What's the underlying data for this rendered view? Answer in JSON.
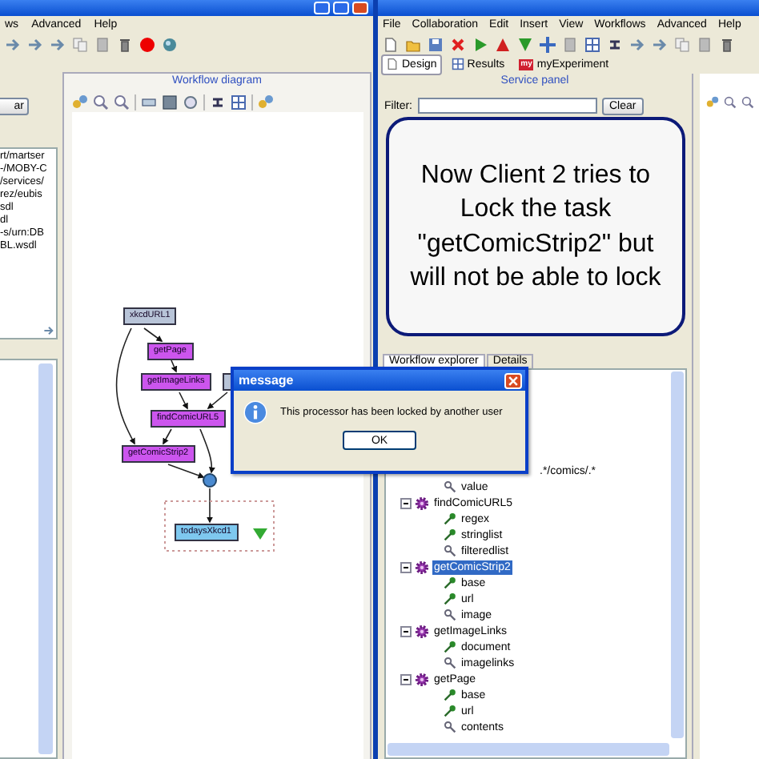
{
  "left_window": {
    "menu": [
      "ws",
      "Advanced",
      "Help"
    ],
    "clear_button": "ar",
    "list_items": [
      "rt/martser",
      "-/MOBY-C",
      "/services/",
      "rez/eubis",
      "sdl",
      "dl",
      "-s/urn:DB",
      "BL.wsdl"
    ],
    "diagram": {
      "title": "Workflow diagram",
      "nodes": [
        {
          "label": "xkcdURL1",
          "kind": "input"
        },
        {
          "label": "getPage",
          "kind": "processor"
        },
        {
          "label": "getImageLinks",
          "kind": "processor"
        },
        {
          "kind": "input"
        },
        {
          "label": "findComicURL5",
          "kind": "processor"
        },
        {
          "label": "getComicStrip2",
          "kind": "processor"
        },
        {
          "label": "todaysXkcd1",
          "kind": "output"
        }
      ]
    }
  },
  "right_window": {
    "menu": [
      "File",
      "Collaboration",
      "Edit",
      "Insert",
      "View",
      "Workflows",
      "Advanced",
      "Help"
    ],
    "tabs": [
      {
        "label": "Design",
        "selected": true
      },
      {
        "label": "Results",
        "selected": false
      },
      {
        "label": "myExperiment",
        "badge": "my",
        "selected": false
      }
    ],
    "service_panel": {
      "title": "Service panel",
      "filter_label": "Filter:",
      "clear_button": "Clear"
    },
    "callout": "Now Client 2 tries to Lock the task \"getComicStrip2\" but will not be able to lock",
    "explorer_tabs": [
      {
        "label": "Workflow explorer",
        "selected": true
      },
      {
        "label": "Details",
        "selected": false
      }
    ],
    "tree": [
      {
        "kind": "fragment",
        "children": [
          {
            "label": ".*/comics/.*",
            "kind": "value",
            "selected": false
          },
          {
            "label": "value",
            "kind": "output",
            "selected": false
          }
        ]
      },
      {
        "label": "findComicURL5",
        "kind": "processor",
        "expanded": true,
        "selected": false,
        "children": [
          {
            "label": "regex",
            "kind": "input",
            "selected": false
          },
          {
            "label": "stringlist",
            "kind": "input",
            "selected": false
          },
          {
            "label": "filteredlist",
            "kind": "output",
            "selected": false
          }
        ]
      },
      {
        "label": "getComicStrip2",
        "kind": "processor",
        "expanded": true,
        "selected": true,
        "children": [
          {
            "label": "base",
            "kind": "input",
            "selected": false
          },
          {
            "label": "url",
            "kind": "input",
            "selected": false
          },
          {
            "label": "image",
            "kind": "output",
            "selected": false
          }
        ]
      },
      {
        "label": "getImageLinks",
        "kind": "processor",
        "expanded": true,
        "selected": false,
        "children": [
          {
            "label": "document",
            "kind": "input",
            "selected": false
          },
          {
            "label": "imagelinks",
            "kind": "output",
            "selected": false
          }
        ]
      },
      {
        "label": "getPage",
        "kind": "processor",
        "expanded": true,
        "selected": false,
        "children": [
          {
            "label": "base",
            "kind": "input",
            "selected": false
          },
          {
            "label": "url",
            "kind": "input",
            "selected": false
          },
          {
            "label": "contents",
            "kind": "output",
            "selected": false
          }
        ]
      }
    ]
  },
  "dialog": {
    "title": "message",
    "message": "This processor has been locked by another user",
    "ok_button": "OK"
  }
}
